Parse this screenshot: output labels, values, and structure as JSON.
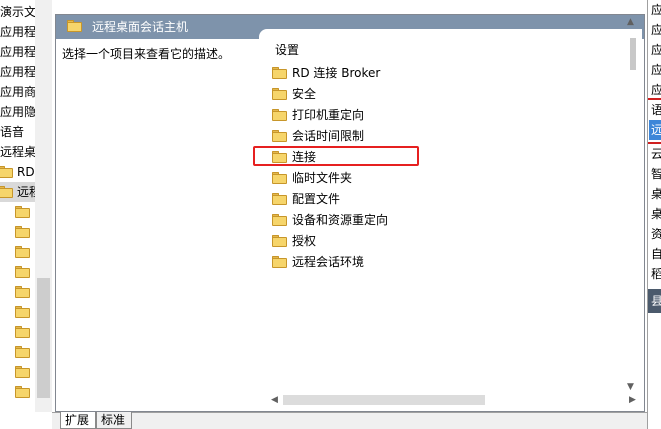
{
  "tree": {
    "items": [
      {
        "label": "演示文",
        "indent": 0,
        "icon": false
      },
      {
        "label": "应用程",
        "indent": 0,
        "icon": false
      },
      {
        "label": "应用程",
        "indent": 0,
        "icon": false
      },
      {
        "label": "应用程",
        "indent": 0,
        "icon": false
      },
      {
        "label": "应用商",
        "indent": 0,
        "icon": false
      },
      {
        "label": "应用隐",
        "indent": 0,
        "icon": false
      },
      {
        "label": "语音",
        "indent": 0,
        "icon": false
      },
      {
        "label": "远程桌",
        "indent": 0,
        "icon": false
      },
      {
        "label": "RD",
        "indent": 1,
        "icon": true
      },
      {
        "label": "远程",
        "indent": 1,
        "icon": true,
        "selected": true
      },
      {
        "label": "",
        "indent": 2,
        "icon": true
      },
      {
        "label": "",
        "indent": 2,
        "icon": true
      },
      {
        "label": "",
        "indent": 2,
        "icon": true
      },
      {
        "label": "",
        "indent": 2,
        "icon": true
      },
      {
        "label": "",
        "indent": 2,
        "icon": true
      },
      {
        "label": "",
        "indent": 2,
        "icon": true
      },
      {
        "label": "",
        "indent": 2,
        "icon": true
      },
      {
        "label": "",
        "indent": 2,
        "icon": true
      },
      {
        "label": "",
        "indent": 2,
        "icon": true
      },
      {
        "label": "",
        "indent": 2,
        "icon": true
      }
    ]
  },
  "center": {
    "title": "远程桌面会话主机",
    "description": "选择一个项目来查看它的描述。",
    "list_header": "设置",
    "items": [
      "RD 连接 Broker",
      "安全",
      "打印机重定向",
      "会话时间限制",
      "连接",
      "临时文件夹",
      "配置文件",
      "设备和资源重定向",
      "授权",
      "远程会话环境"
    ]
  },
  "tabs": {
    "extended": "扩展",
    "standard": "标准"
  },
  "actions": {
    "items": [
      "应",
      "应",
      "应",
      "应",
      "应",
      "语",
      "远",
      "云",
      "智",
      "桌",
      "桌",
      "资",
      "自",
      "稻"
    ],
    "selected_index": 6,
    "group_label": "县"
  },
  "colors": {
    "header_bg": "#7e93ab",
    "highlight_border": "#e62020",
    "selection_blue": "#3d86d8",
    "folder_yellow": "#f6d56b"
  }
}
